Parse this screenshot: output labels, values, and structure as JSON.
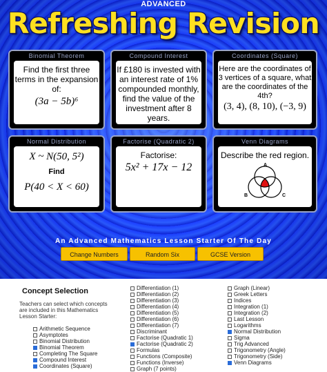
{
  "header": {
    "level": "ADVANCED",
    "title": "Refreshing Revision"
  },
  "cards": [
    {
      "heading": "Binomial Theorem",
      "text": "Find the first three terms in the expansion of:",
      "math": "(3a − 5b)⁶"
    },
    {
      "heading": "Compound Interest",
      "text": "If £180 is invested with an interest rate of 1% compounded monthly, find the value of the investment after 8 years."
    },
    {
      "heading": "Coordinates (Square)",
      "text": "Here are the coordinates of 3 vertices of a square, what are the coordinates of the 4th?",
      "math": "(3, 4), (8, 10), (−3, 9)"
    },
    {
      "heading": "Normal Distribution",
      "math": "X ~ N(50, 5²)",
      "find": "Find",
      "math2": "P(40 < X < 60)"
    },
    {
      "heading": "Factorise (Quadratic 2)",
      "text": "Factorise:",
      "math": "5x² + 17x − 12"
    },
    {
      "heading": "Venn Diagrams",
      "text": "Describe the red region.",
      "labels": [
        "A",
        "B",
        "C"
      ]
    }
  ],
  "subtitle": "An Advanced Mathematics Lesson Starter Of The Day",
  "buttons": [
    "Change Numbers",
    "Random Six",
    "GCSE Version"
  ],
  "concept": {
    "title": "Concept Selection",
    "description": "Teachers can select which concepts are included in this Mathematics Lesson Starter:",
    "col1": [
      {
        "label": "Arithmetic Sequence",
        "checked": false
      },
      {
        "label": "Asymptotes",
        "checked": false
      },
      {
        "label": "Binomial Distribution",
        "checked": false
      },
      {
        "label": "Binomial Theorem",
        "checked": true
      },
      {
        "label": "Completing The Square",
        "checked": false
      },
      {
        "label": "Compound Interest",
        "checked": true
      },
      {
        "label": "Coordinates (Square)",
        "checked": true
      }
    ],
    "col2": [
      {
        "label": "Differentiation (1)",
        "checked": false
      },
      {
        "label": "Differentiation (2)",
        "checked": false
      },
      {
        "label": "Differentiation (3)",
        "checked": false
      },
      {
        "label": "Differentiation (4)",
        "checked": false
      },
      {
        "label": "Differentiation (5)",
        "checked": false
      },
      {
        "label": "Differentiation (6)",
        "checked": false
      },
      {
        "label": "Differentiation (7)",
        "checked": false
      },
      {
        "label": "Discriminant",
        "checked": false
      },
      {
        "label": "Factorise (Quadratic 1)",
        "checked": false
      },
      {
        "label": "Factorise (Quadratic 2)",
        "checked": true
      },
      {
        "label": "Formulas",
        "checked": false
      },
      {
        "label": "Functions (Composite)",
        "checked": false
      },
      {
        "label": "Functions (Inverse)",
        "checked": false
      },
      {
        "label": "Graph (7 points)",
        "checked": false
      }
    ],
    "col3": [
      {
        "label": "Graph (Linear)",
        "checked": false
      },
      {
        "label": "Greek Letters",
        "checked": false
      },
      {
        "label": "Indices",
        "checked": false
      },
      {
        "label": "Integration (1)",
        "checked": false
      },
      {
        "label": "Integration (2)",
        "checked": false
      },
      {
        "label": "Last Lesson",
        "checked": false
      },
      {
        "label": "Logarithms",
        "checked": false
      },
      {
        "label": "Normal Distribution",
        "checked": true
      },
      {
        "label": "Sigma",
        "checked": false
      },
      {
        "label": "Trig Advanced",
        "checked": false
      },
      {
        "label": "Trigonometry (Angle)",
        "checked": false
      },
      {
        "label": "Trigonometry (Side)",
        "checked": false
      },
      {
        "label": "Venn Diagrams",
        "checked": true
      }
    ]
  }
}
